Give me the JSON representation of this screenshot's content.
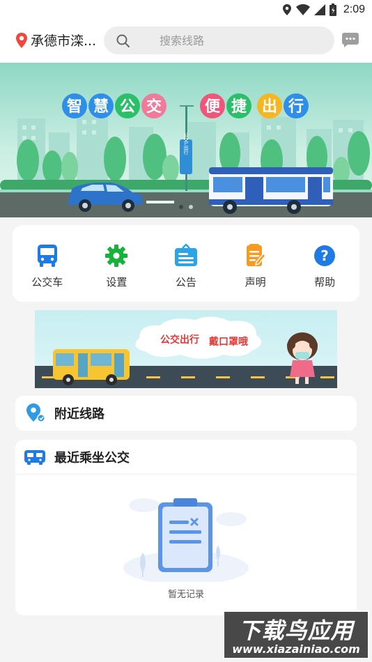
{
  "status_bar": {
    "time": "2:09",
    "icons": [
      "location-icon",
      "wifi-icon",
      "signal-icon",
      "battery-icon"
    ]
  },
  "header": {
    "location": "承德市滦...",
    "search_placeholder": "搜索线路",
    "icons": [
      "pin-icon",
      "search-icon",
      "message-icon"
    ]
  },
  "banner": {
    "slogan_left": [
      "智",
      "慧",
      "公",
      "交"
    ],
    "slogan_right": [
      "便",
      "捷",
      "出",
      "行"
    ],
    "sign_text": "公交L出行",
    "pages": 2,
    "active_page": 1
  },
  "menu": {
    "items": [
      {
        "label": "公交车",
        "icon": "bus-icon",
        "color": "#1e7be6"
      },
      {
        "label": "设置",
        "icon": "gear-icon",
        "color": "#16b23a"
      },
      {
        "label": "公告",
        "icon": "notice-icon",
        "color": "#2aa6e8"
      },
      {
        "label": "声明",
        "icon": "statement-icon",
        "color": "#f59a23"
      },
      {
        "label": "帮助",
        "icon": "help-icon",
        "color": "#1e7be6"
      }
    ]
  },
  "ad": {
    "text_a": "公交出行",
    "text_b": "戴口罩哦"
  },
  "nearby": {
    "title": "附近线路",
    "icon": "nearby-route-icon"
  },
  "recent": {
    "title": "最近乘坐公交",
    "icon": "bus-front-icon",
    "empty_text": "暂无记录"
  },
  "watermark": {
    "main": "下载鸟应用",
    "url": "www.xiazainiao.com"
  },
  "colors": {
    "accent": "#1e7be6",
    "pin_red": "#f1453d",
    "background": "#f4f4f4"
  }
}
